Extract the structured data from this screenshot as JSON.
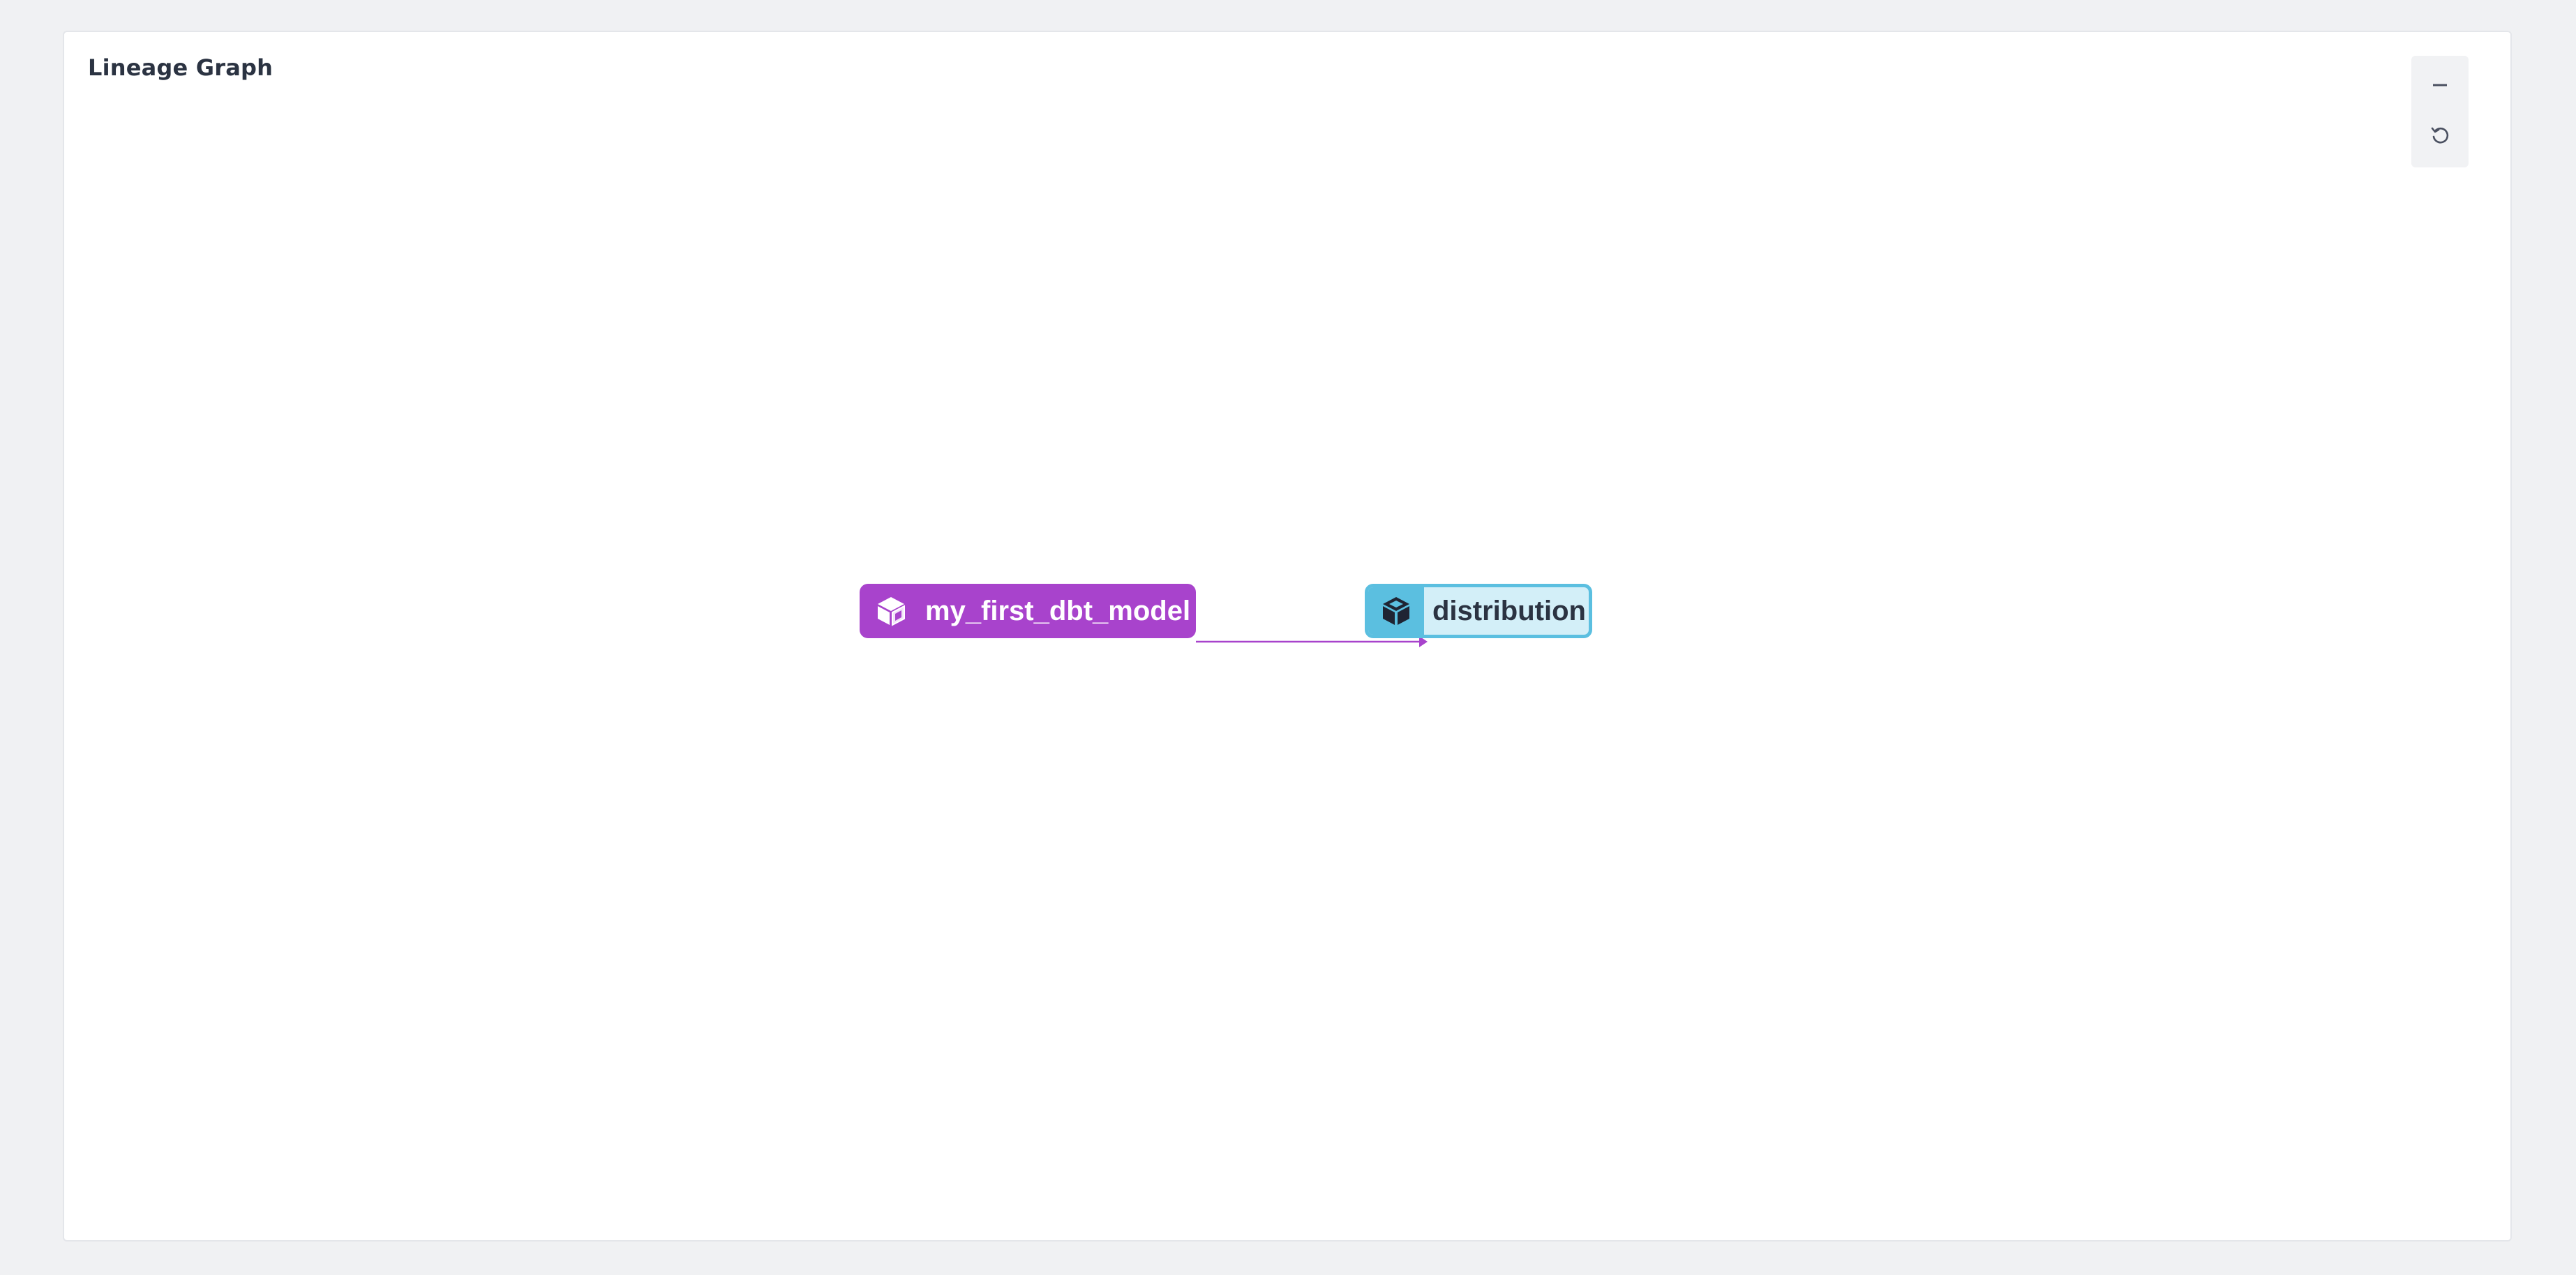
{
  "panel": {
    "title": "Lineage Graph"
  },
  "controls": {
    "zoom_out_icon": "minus-icon",
    "reset_icon": "reset-icon"
  },
  "graph": {
    "nodes": [
      {
        "id": "my_first_dbt_model",
        "label": "my_first_dbt_model",
        "icon": "cube-icon",
        "color": "#a843cc",
        "selected": false
      },
      {
        "id": "distribution",
        "label": "distribution",
        "icon": "cube-icon",
        "color": "#5bbfe0",
        "selected": true
      }
    ],
    "edges": [
      {
        "from": "my_first_dbt_model",
        "to": "distribution",
        "color": "#a843cc"
      }
    ]
  }
}
